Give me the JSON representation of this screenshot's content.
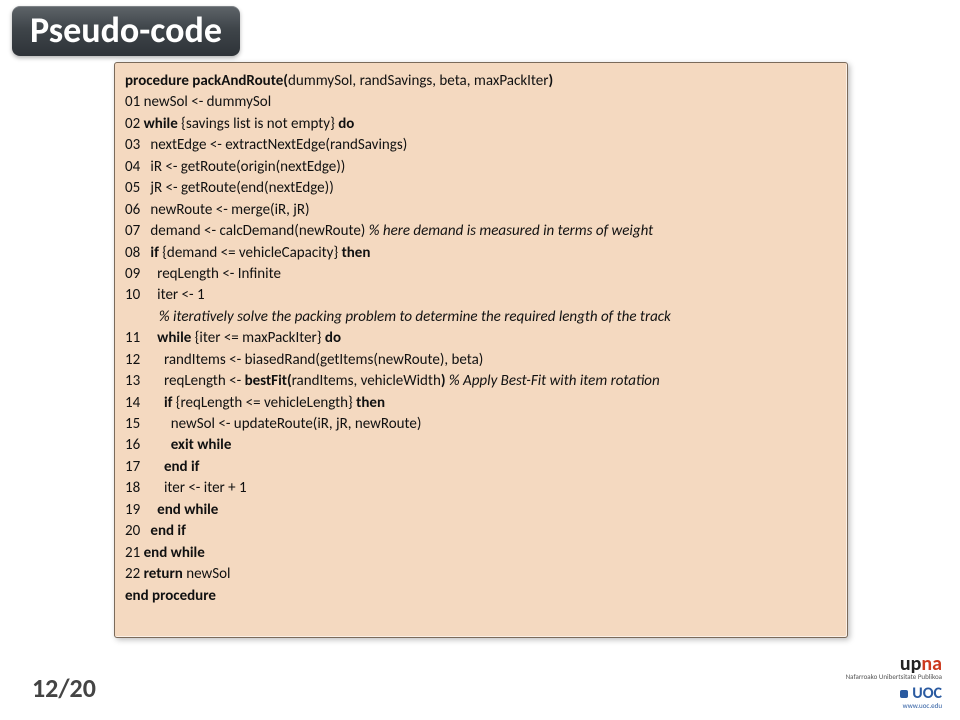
{
  "title": "Pseudo-code",
  "pager": "12/20",
  "logos": {
    "upna_up": "up",
    "upna_na": "na",
    "upna_sub": "Nafarroako\nUnibertsitate Publikoa",
    "uoc": "UOC",
    "uoc_sub": "www.uoc.edu"
  },
  "code": {
    "l00a": "procedure packAndRoute(",
    "l00b": "dummySol, randSavings, beta, maxPackIter",
    "l00c": ")",
    "l01": "01 newSol <- dummySol",
    "l02a": "02 ",
    "l02b": "while ",
    "l02c": "{savings list is not empty} ",
    "l02d": "do",
    "l03": "03   nextEdge <- extractNextEdge(randSavings)",
    "l04": "04   iR <- getRoute(origin(nextEdge))",
    "l05": "05   jR <- getRoute(end(nextEdge))",
    "l06": "06   newRoute <- merge(iR, jR)",
    "l07a": "07   demand <- calcDemand(newRoute) ",
    "l07b": "% here demand is measured in terms of weight",
    "l08a": "08   ",
    "l08b": "if ",
    "l08c": "{demand <= vehicleCapacity} ",
    "l08d": "then",
    "l09": "09     reqLength <- Infinite",
    "l10": "10     iter <- 1",
    "l10c": "          % iteratively solve the packing problem to determine the required length of the track",
    "l11a": "11     ",
    "l11b": "while ",
    "l11c": "{iter <= maxPackIter} ",
    "l11d": "do",
    "l12": "12       randItems <- biasedRand(getItems(newRoute), beta)",
    "l13a": "13       reqLength <- ",
    "l13b": "bestFit(",
    "l13c": "randItems, vehicleWidth",
    "l13d": ") ",
    "l13e": "% Apply Best-Fit with item rotation",
    "l14a": "14       ",
    "l14b": "if ",
    "l14c": "{reqLength <= vehicleLength} ",
    "l14d": "then",
    "l15": "15         newSol <- updateRoute(iR, jR, newRoute)",
    "l16a": "16         ",
    "l16b": "exit while",
    "l17a": "17       ",
    "l17b": "end if",
    "l18": "18       iter <- iter + 1",
    "l19a": "19     ",
    "l19b": "end while",
    "l20a": "20   ",
    "l20b": "end if",
    "l21a": "21 ",
    "l21b": "end while",
    "l22a": "22 ",
    "l22b": "return ",
    "l22c": "newSol",
    "l23": "end procedure"
  }
}
